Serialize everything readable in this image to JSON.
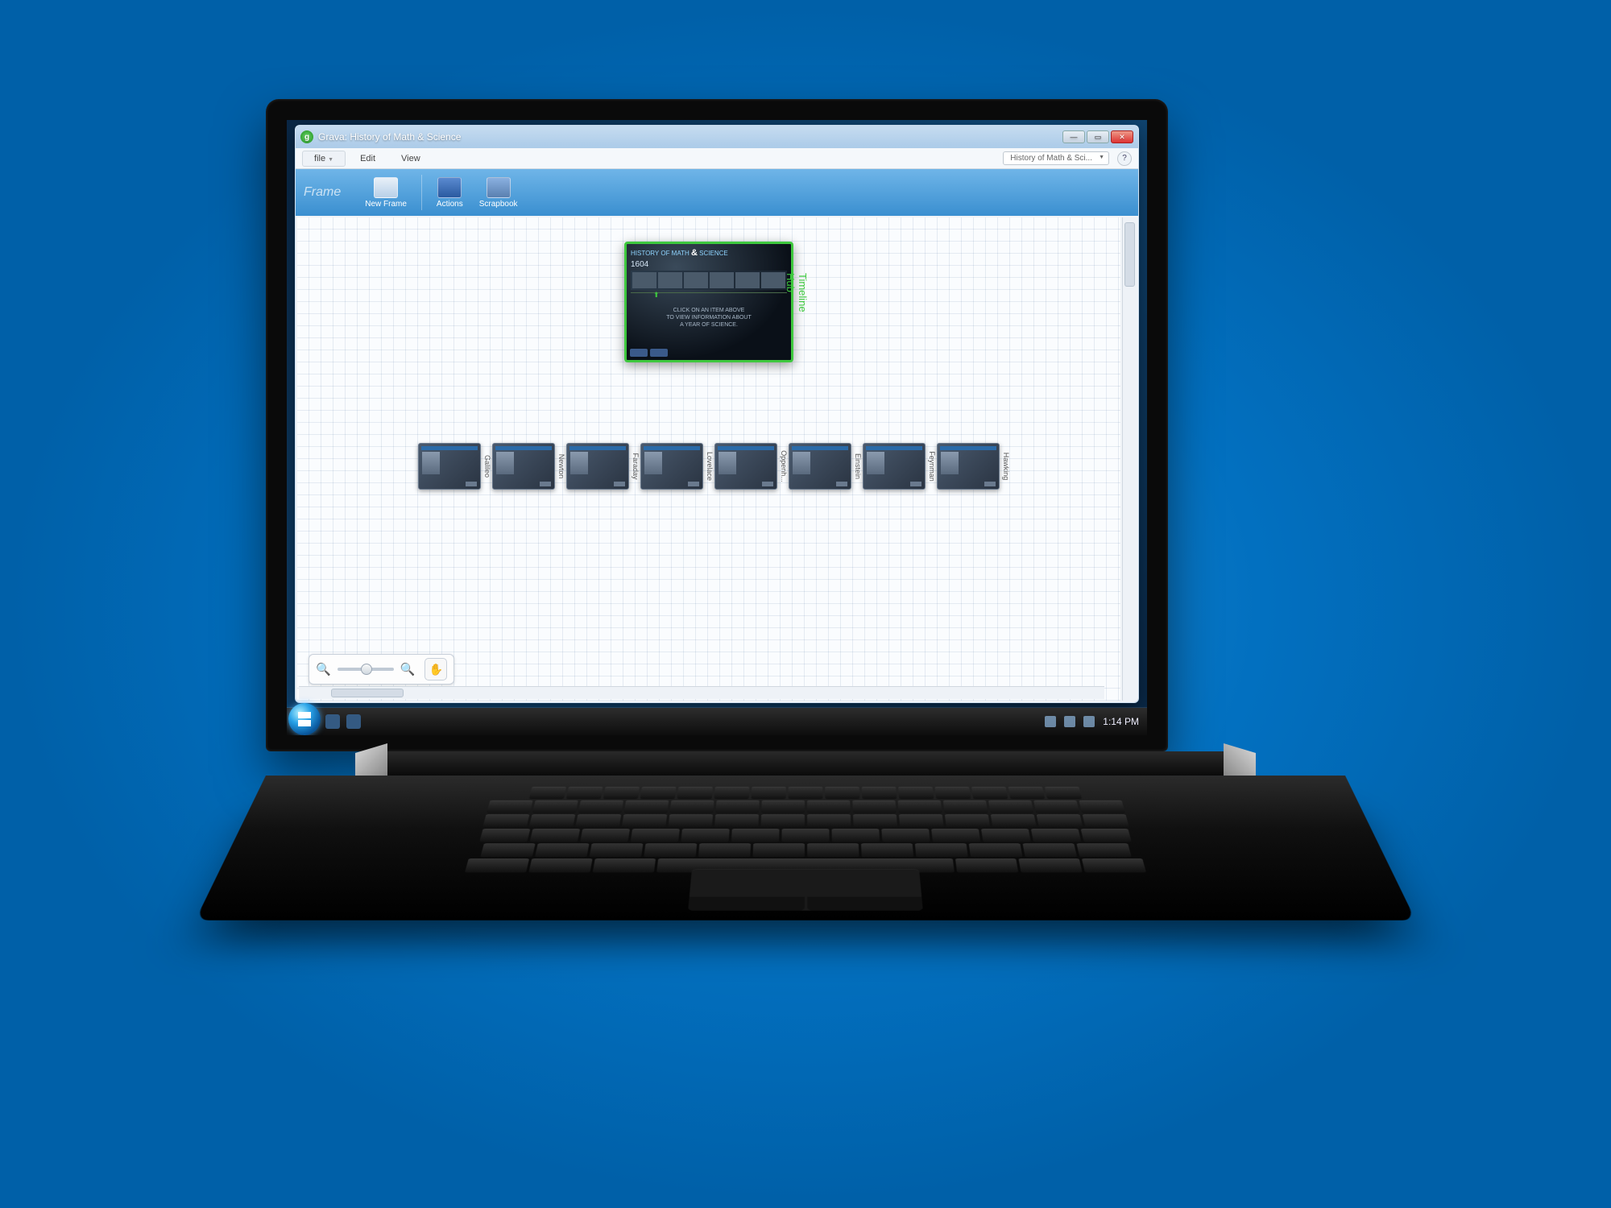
{
  "window": {
    "title": "Grava: History of Math & Science"
  },
  "menubar": {
    "file": "file",
    "edit": "Edit",
    "view": "View",
    "project_dropdown": "History of Math & Sci...",
    "help": "?"
  },
  "ribbon": {
    "section": "Frame",
    "new_frame": "New Frame",
    "actions": "Actions",
    "scrapbook": "Scrapbook"
  },
  "hub": {
    "title_prefix": "HISTORY OF MATH",
    "title_amp": "&",
    "title_suffix": "SCIENCE",
    "year": "1604",
    "hint": "CLICK ON AN ITEM ABOVE\nTO VIEW INFORMATION ABOUT\nA YEAR OF SCIENCE.",
    "side_label": "Timeline Hub"
  },
  "cards": [
    {
      "label": "Galileo"
    },
    {
      "label": "Newton"
    },
    {
      "label": "Faraday"
    },
    {
      "label": "Lovelace"
    },
    {
      "label": "Oppenh..."
    },
    {
      "label": "Einstein"
    },
    {
      "label": "Feynman"
    },
    {
      "label": "Hawking"
    }
  ],
  "taskbar": {
    "time": "1:14 PM"
  }
}
